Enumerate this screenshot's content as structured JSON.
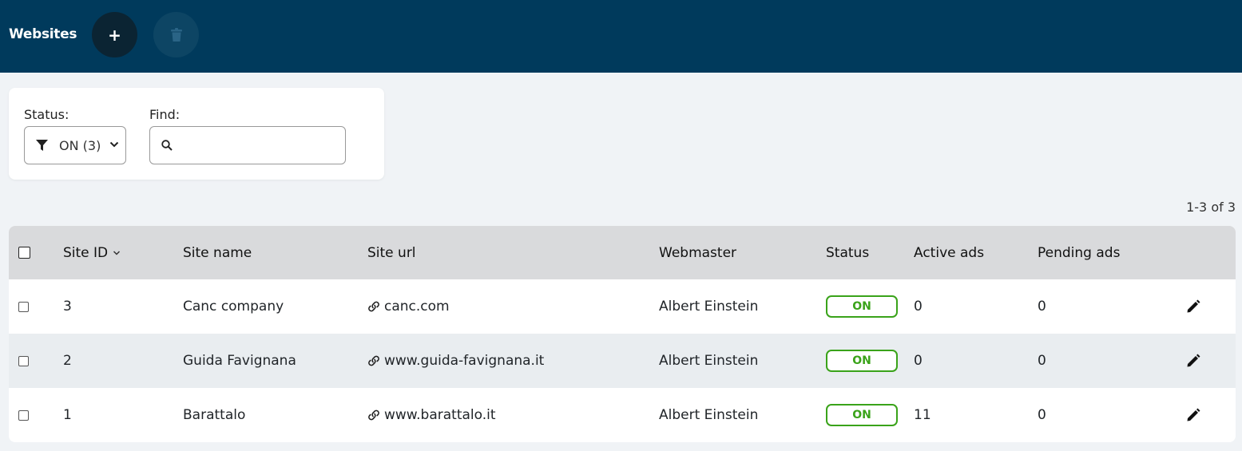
{
  "header": {
    "title": "Websites",
    "add_label": "+",
    "background": "#003a5c"
  },
  "filters": {
    "status_label": "Status:",
    "status_value": "ON (3)",
    "find_label": "Find:",
    "find_value": "",
    "find_placeholder": ""
  },
  "pagination": {
    "text": "1-3 of 3"
  },
  "table": {
    "columns": {
      "site_id": "Site ID",
      "site_name": "Site name",
      "site_url": "Site url",
      "webmaster": "Webmaster",
      "status": "Status",
      "active_ads": "Active ads",
      "pending_ads": "Pending ads"
    },
    "rows": [
      {
        "id": "3",
        "name": "Canc company",
        "url": "canc.com",
        "webmaster": "Albert Einstein",
        "status": "ON",
        "active": "0",
        "pending": "0"
      },
      {
        "id": "2",
        "name": "Guida Favignana",
        "url": "www.guida-favignana.it",
        "webmaster": "Albert Einstein",
        "status": "ON",
        "active": "0",
        "pending": "0"
      },
      {
        "id": "1",
        "name": "Barattalo",
        "url": "www.barattalo.it",
        "webmaster": "Albert Einstein",
        "status": "ON",
        "active": "11",
        "pending": "0"
      }
    ]
  },
  "colors": {
    "accent": "#003a5c",
    "status_on": "#3aa31a"
  },
  "icons": [
    "plus-icon",
    "trash-icon",
    "filter-icon",
    "chevron-down-icon",
    "search-icon",
    "link-icon",
    "pencil-icon"
  ]
}
